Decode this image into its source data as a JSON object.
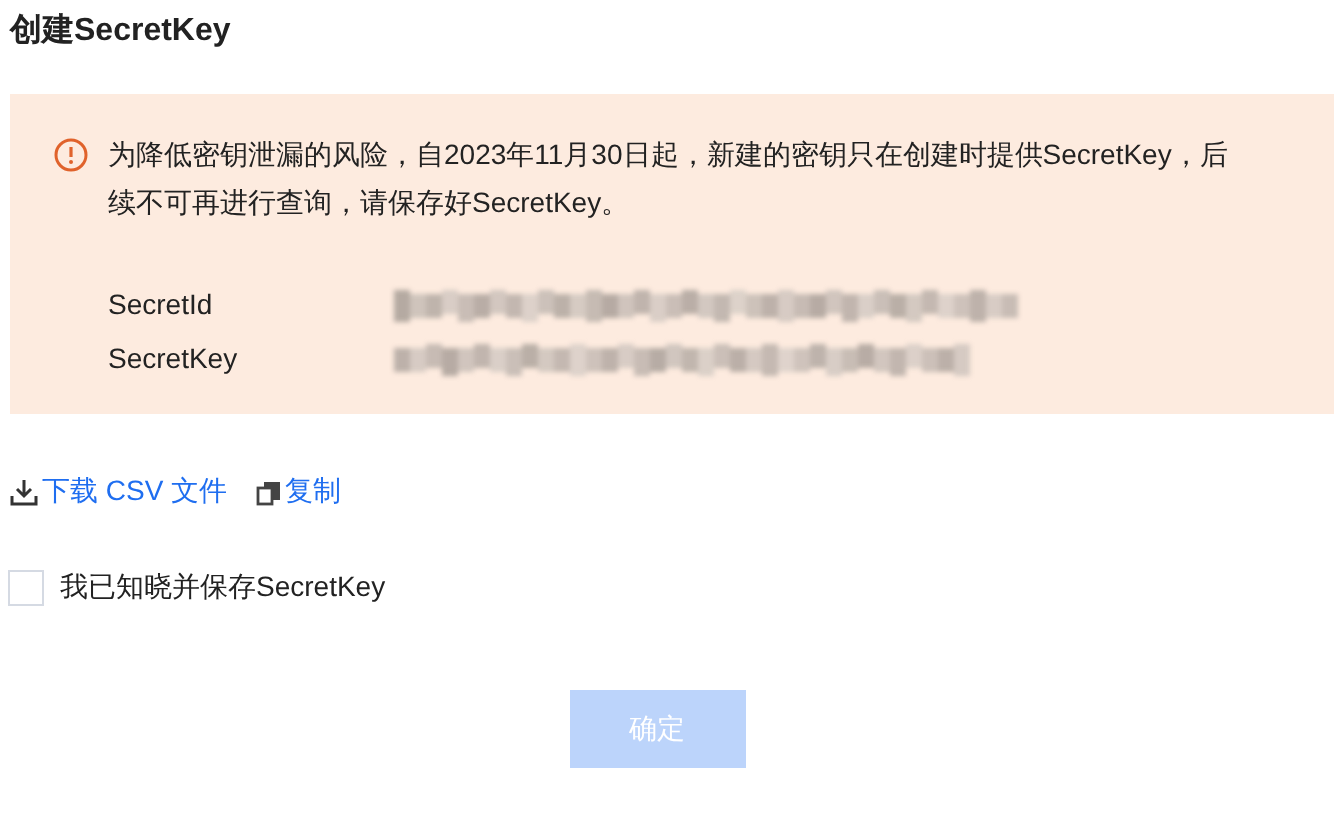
{
  "title": "创建SecretKey",
  "notice": {
    "text": "为降低密钥泄漏的风险，自2023年11月30日起，新建的密钥只在创建时提供SecretKey，后续不可再进行查询，请保存好SecretKey。",
    "fields": [
      {
        "label": "SecretId"
      },
      {
        "label": "SecretKey"
      }
    ]
  },
  "actions": [
    {
      "kind": "download",
      "label": "下载 CSV 文件"
    },
    {
      "kind": "copy",
      "label": "复制"
    }
  ],
  "confirm_checkbox": {
    "label": "我已知晓并保存SecretKey",
    "checked": false
  },
  "submit_button": {
    "label": "确定",
    "disabled": true
  }
}
